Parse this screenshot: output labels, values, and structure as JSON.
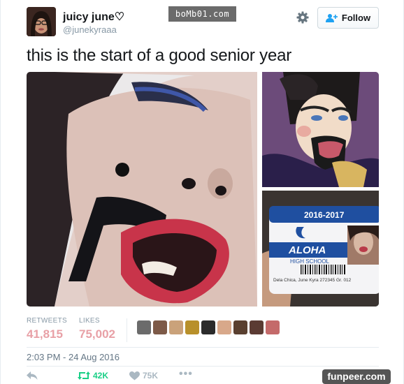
{
  "header": {
    "display_name": "juicy june♡",
    "handle": "@junekyraaa",
    "follow_label": "Follow"
  },
  "watermarks": {
    "top": "boMb01.com",
    "bottom": "funpeer.com"
  },
  "tweet": {
    "text": "this is the start of a good senior year",
    "media": {
      "id_card_year": "2016-2017",
      "id_card_school": "ALOHA",
      "id_card_school_sub": "HIGH SCHOOL",
      "id_card_name_line": "Dela Chica, June Kyra   272345   Gr. 012"
    }
  },
  "stats": {
    "retweets_label": "RETWEETS",
    "retweets_value": "41,815",
    "likes_label": "LIKES",
    "likes_value": "75,002"
  },
  "timestamp": "2:03 PM - 24 Aug 2016",
  "actions": {
    "retweet_count": "42K",
    "like_count": "75K",
    "more": "•••"
  },
  "colors": {
    "stat_value": "#e8a0a6",
    "retweet": "#19cf86",
    "muted": "#8899a6",
    "id_card_blue": "#1f4fa0"
  },
  "liker_colors": [
    "#6b6b6b",
    "#7d5a48",
    "#caa27a",
    "#b8902a",
    "#2b2b2b",
    "#d8a88a",
    "#5a4030",
    "#5b3b33",
    "#c46a6a"
  ]
}
